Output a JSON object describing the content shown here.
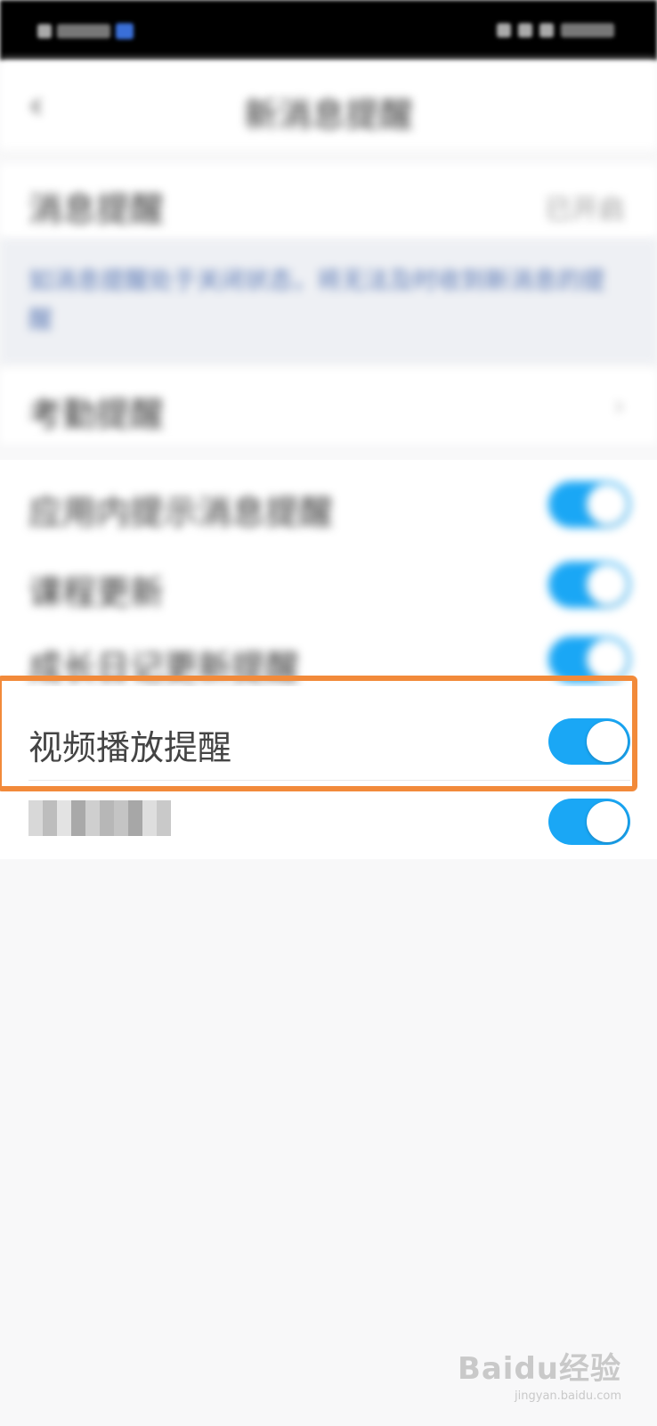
{
  "statusbar": {
    "left_text": "",
    "right_text": ""
  },
  "navbar": {
    "title": "新消息提醒"
  },
  "rows": {
    "message_alert": {
      "label": "消息提醒",
      "value": "已开启"
    },
    "notice_text": "如消息提醒处于关闭状态，将无法及时收到新消息的提醒",
    "attendance_alert": {
      "label": "考勤提醒"
    }
  },
  "toggles": [
    {
      "label": "应用内提示消息提醒",
      "on": true
    },
    {
      "label": "课程更新",
      "on": true
    },
    {
      "label": "成长日记更新提醒",
      "on": true
    },
    {
      "label": "视频播放提醒",
      "on": true
    },
    {
      "label": "",
      "on": true
    }
  ],
  "colors": {
    "accent": "#1aa7f5",
    "highlight": "#f28a3a"
  },
  "watermark": {
    "main": "Baidu经验",
    "sub": "jingyan.baidu.com"
  }
}
